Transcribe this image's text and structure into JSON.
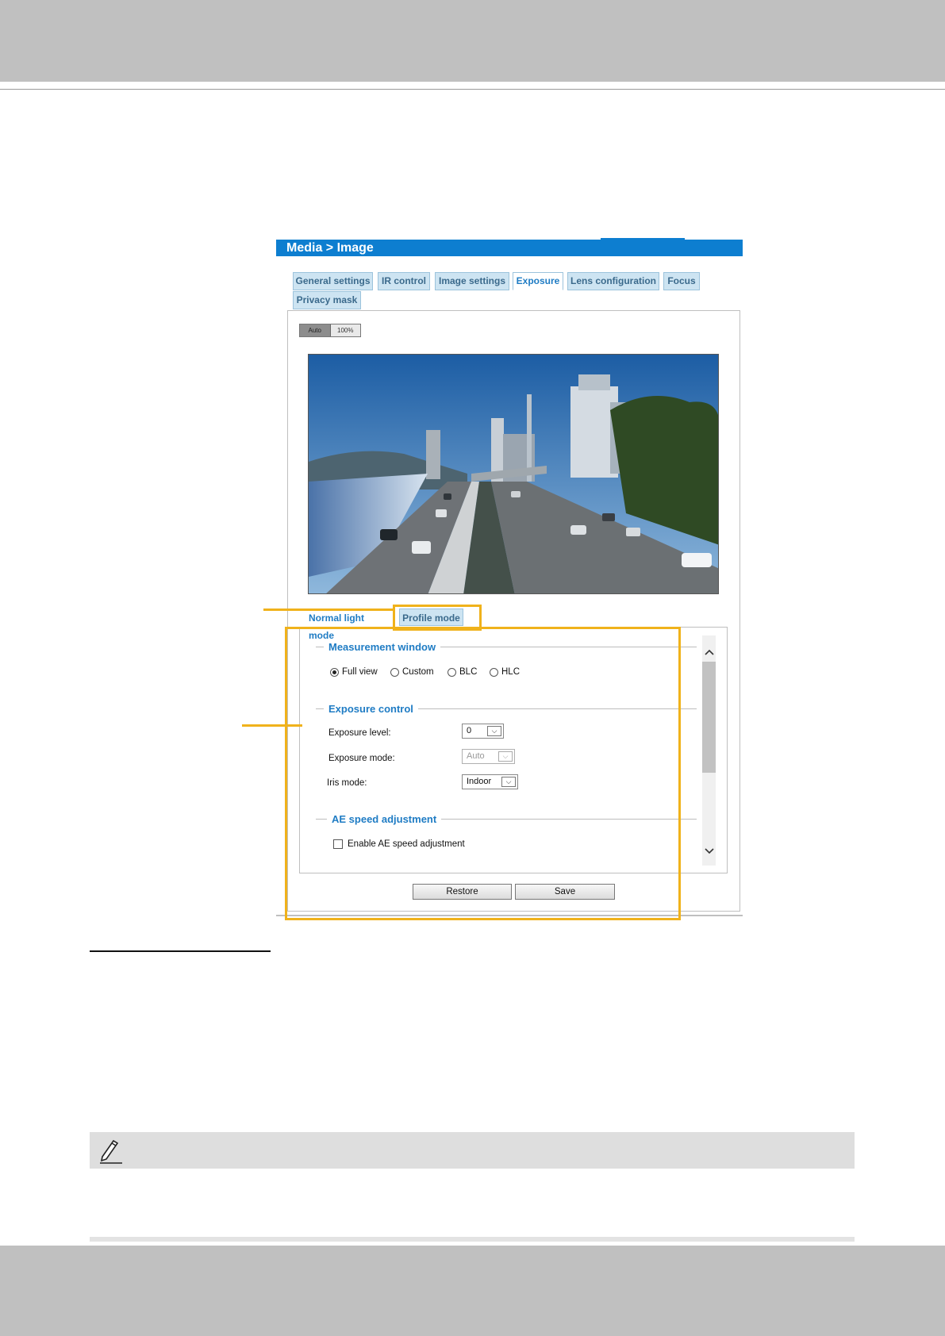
{
  "header": {
    "title": "Media  > Image"
  },
  "tabs": [
    {
      "label": "General settings",
      "active": false
    },
    {
      "label": "IR control",
      "active": false
    },
    {
      "label": "Image settings",
      "active": false
    },
    {
      "label": "Exposure",
      "active": true
    },
    {
      "label": "Lens configuration",
      "active": false
    },
    {
      "label": "Focus",
      "active": false
    },
    {
      "label": "Privacy mask",
      "active": false
    }
  ],
  "viewer": {
    "zoom_auto_label": "Auto",
    "zoom_100_label": "100%"
  },
  "mode_tabs": [
    {
      "label": "Normal light mode",
      "active": true
    },
    {
      "label": "Profile mode",
      "active": false
    }
  ],
  "measurement_window": {
    "title": "Measurement window",
    "options": [
      "Full view",
      "Custom",
      "BLC",
      "HLC"
    ],
    "selected": "Full view"
  },
  "exposure_control": {
    "title": "Exposure control",
    "exposure_level": {
      "label": "Exposure level:",
      "value": "0"
    },
    "exposure_mode": {
      "label": "Exposure mode:",
      "value": "Auto",
      "disabled": true
    },
    "iris_mode": {
      "label": "Iris mode:",
      "value": "Indoor"
    }
  },
  "ae_speed": {
    "title": "AE speed adjustment",
    "checkbox_label": "Enable AE speed adjustment",
    "checked": false
  },
  "buttons": {
    "restore": "Restore",
    "save": "Save"
  },
  "colors": {
    "accent_blue": "#0d7ed0",
    "highlight_yellow": "#f0b21b",
    "section_title_blue": "#1f7cc4",
    "tab_bg": "#cde4f2"
  },
  "icons": [
    "chevron-up-icon",
    "chevron-down-icon",
    "pencil-note-icon",
    "dropdown-arrow-icon"
  ]
}
